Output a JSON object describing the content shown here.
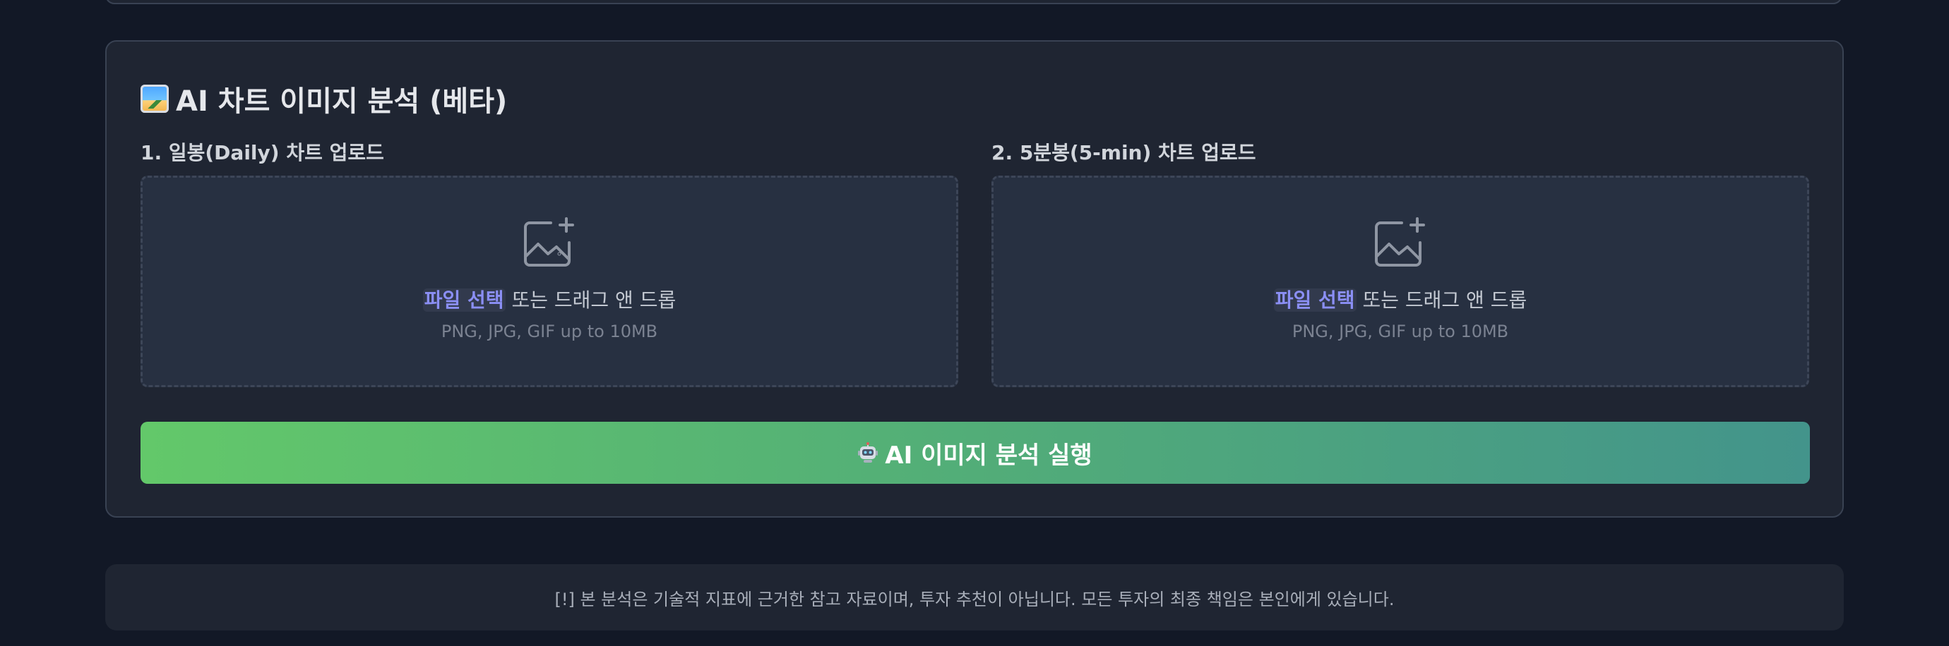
{
  "panel": {
    "title": "AI 차트 이미지 분석 (베타)",
    "title_icon": "framed-picture-icon"
  },
  "uploads": [
    {
      "label": "1. 일봉(Daily) 차트 업로드",
      "file_select": "파일 선택",
      "drag_text": " 또는 드래그 앤 드롭",
      "hint": "PNG, JPG, GIF up to 10MB",
      "icon": "image-add-icon"
    },
    {
      "label": "2. 5분봉(5-min) 차트 업로드",
      "file_select": "파일 선택",
      "drag_text": " 또는 드래그 앤 드롭",
      "hint": "PNG, JPG, GIF up to 10MB",
      "icon": "image-add-icon"
    }
  ],
  "analyze_button": {
    "label": "AI 이미지 분석 실행",
    "icon": "robot-icon"
  },
  "disclaimer": {
    "text": "[!] 본 분석은 기술적 지표에 근거한 참고 자료이며, 투자 추천이 아닙니다. 모든 투자의 최종 책임은 본인에게 있습니다."
  },
  "colors": {
    "background": "#121826",
    "panel": "#1f2532",
    "accent_link": "#8b8ff5",
    "button_start": "#63c86a",
    "button_end": "#43948b"
  }
}
